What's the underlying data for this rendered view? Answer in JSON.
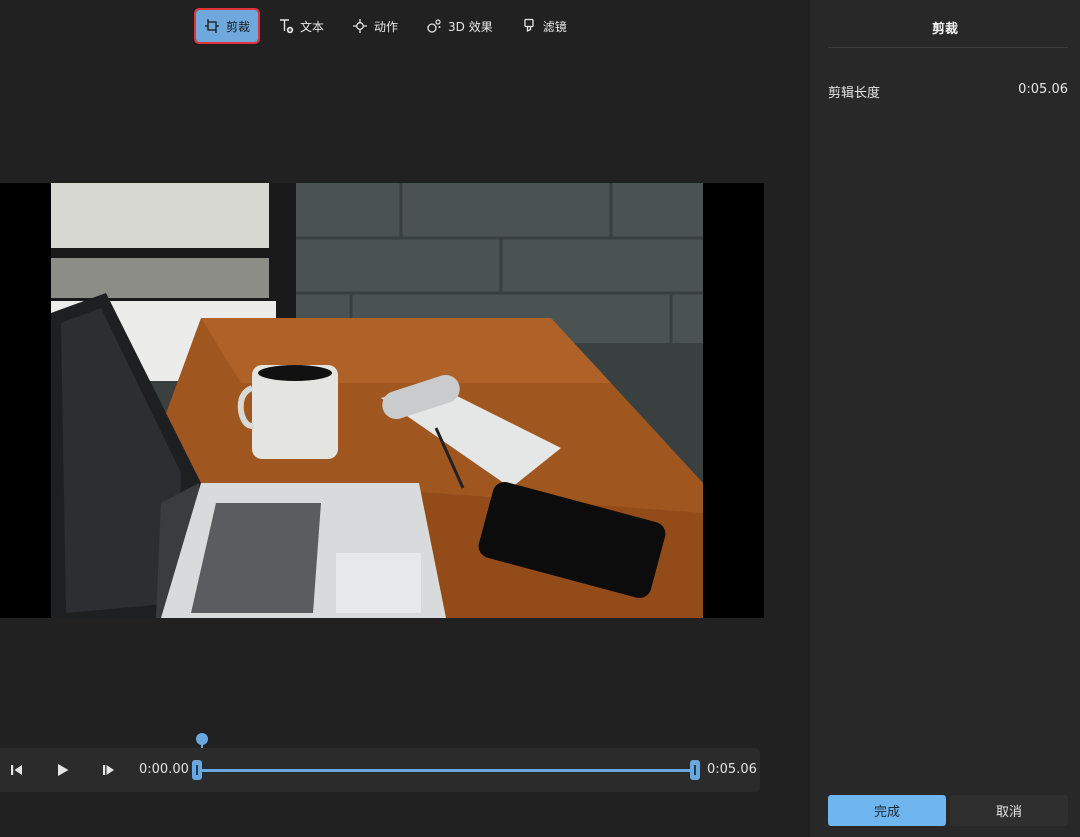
{
  "toolbar": {
    "items": [
      {
        "label": "剪裁",
        "icon": "trim-icon",
        "active": true
      },
      {
        "label": "文本",
        "icon": "add-text-icon"
      },
      {
        "label": "动作",
        "icon": "motion-icon"
      },
      {
        "label": "3D 效果",
        "icon": "effects-3d-icon"
      },
      {
        "label": "滤镜",
        "icon": "filter-icon"
      }
    ]
  },
  "playback": {
    "current_time": "0:00.00",
    "end_time": "0:05.06",
    "playhead_fraction": 0.0,
    "trim_start_fraction": 0.0,
    "trim_end_fraction": 1.0
  },
  "panel": {
    "title": "剪裁",
    "clip_length_label": "剪辑长度",
    "clip_length_value": "0:05.06",
    "done_label": "完成",
    "cancel_label": "取消"
  },
  "colors": {
    "accent": "#6fb5f0",
    "active_outline": "#e0343b",
    "background": "#212121",
    "panel": "#282828"
  }
}
